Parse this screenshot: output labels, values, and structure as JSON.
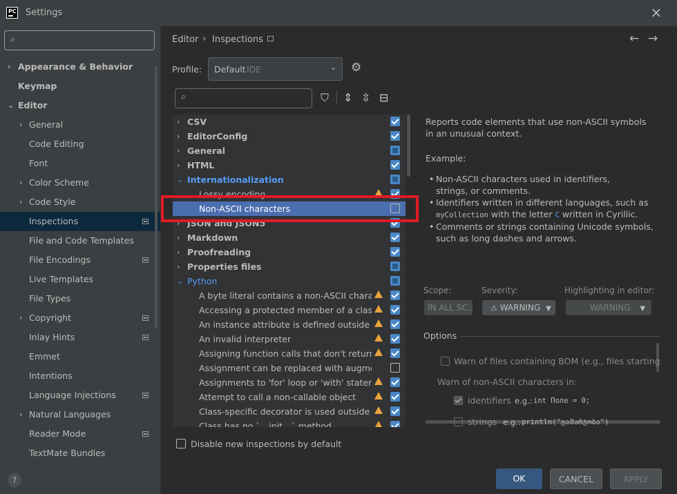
{
  "window": {
    "title": "Settings",
    "logo_text": "PC"
  },
  "sidebar": {
    "items": [
      {
        "label": "Appearance & Behavior",
        "chevron": "›"
      },
      {
        "label": "Keymap",
        "chevron": ""
      },
      {
        "label": "Editor",
        "chevron": "⌄"
      },
      {
        "label": "General",
        "chevron": "›"
      },
      {
        "label": "Code Editing",
        "chevron": ""
      },
      {
        "label": "Font",
        "chevron": ""
      },
      {
        "label": "Color Scheme",
        "chevron": "›"
      },
      {
        "label": "Code Style",
        "chevron": "›"
      },
      {
        "label": "Inspections",
        "chevron": ""
      },
      {
        "label": "File and Code Templates",
        "chevron": ""
      },
      {
        "label": "File Encodings",
        "chevron": ""
      },
      {
        "label": "Live Templates",
        "chevron": ""
      },
      {
        "label": "File Types",
        "chevron": ""
      },
      {
        "label": "Copyright",
        "chevron": "›"
      },
      {
        "label": "Inlay Hints",
        "chevron": ""
      },
      {
        "label": "Emmet",
        "chevron": ""
      },
      {
        "label": "Intentions",
        "chevron": ""
      },
      {
        "label": "Language Injections",
        "chevron": ""
      },
      {
        "label": "Natural Languages",
        "chevron": "›"
      },
      {
        "label": "Reader Mode",
        "chevron": ""
      },
      {
        "label": "TextMate Bundles",
        "chevron": ""
      }
    ],
    "help": "?"
  },
  "header": {
    "breadcrumb_parent": "Editor",
    "breadcrumb_sep": "›",
    "breadcrumb_current": "Inspections",
    "back": "←",
    "forward": "→"
  },
  "profile": {
    "label": "Profile:",
    "value": "Default",
    "scope": "IDE"
  },
  "tree": {
    "rows": [
      {
        "label": "CSV",
        "chevron": "›"
      },
      {
        "label": "EditorConfig",
        "chevron": "›"
      },
      {
        "label": "General",
        "chevron": "›"
      },
      {
        "label": "HTML",
        "chevron": "›"
      },
      {
        "label": "Internationalization",
        "chevron": "⌄"
      },
      {
        "label": "Lossy encoding",
        "chevron": ""
      },
      {
        "label": "Non-ASCII characters",
        "chevron": ""
      },
      {
        "label": "JSON and JSON5",
        "chevron": "›"
      },
      {
        "label": "Markdown",
        "chevron": "›"
      },
      {
        "label": "Proofreading",
        "chevron": "›"
      },
      {
        "label": "Properties files",
        "chevron": "›"
      },
      {
        "label": "Python",
        "chevron": "⌄"
      },
      {
        "label": "A byte literal contains a non-ASCII character",
        "chevron": ""
      },
      {
        "label": "Accessing a protected member of a class or a",
        "chevron": ""
      },
      {
        "label": "An instance attribute is defined outside `__init_",
        "chevron": ""
      },
      {
        "label": "An invalid interpreter",
        "chevron": ""
      },
      {
        "label": "Assigning function calls that don't return anyth",
        "chevron": ""
      },
      {
        "label": "Assignment can be replaced with augmented a",
        "chevron": ""
      },
      {
        "label": "Assignments to 'for' loop or 'with' statement p",
        "chevron": ""
      },
      {
        "label": "Attempt to call a non-callable object",
        "chevron": ""
      },
      {
        "label": "Class-specific decorator is used outside the cla",
        "chevron": ""
      },
      {
        "label": "Class has no `__init__` method",
        "chevron": ""
      }
    ],
    "disable_new_label": "Disable new inspections by default"
  },
  "description": {
    "summary": "Reports code elements that use non-ASCII symbols in an unusual context.",
    "example_label": "Example:",
    "bullet1": "Non-ASCII characters used in identifiers, strings, or comments.",
    "bullet2_a": "Identifiers written in different languages, such as",
    "bullet2_code1": "myCollection",
    "bullet2_b": "with the letter",
    "bullet2_code2": "C",
    "bullet2_c": "written in Cyrillic.",
    "bullet3": "Comments or strings containing Unicode symbols, such as long dashes and arrows."
  },
  "settings": {
    "scope_label": "Scope:",
    "scope_value": "IN ALL SC...",
    "severity_label": "Severity:",
    "severity_value": "WARNING",
    "highlight_label": "Highlighting in editor:",
    "highlight_value": "WARNING"
  },
  "options": {
    "title": "Options",
    "bom_label": "Warn of files containing BOM (e.g., files starting with 'F",
    "warn_in_label": "Warn of non-ASCII characters in:",
    "identifiers_label": "identifiers",
    "identifiers_eg": "e.g.:",
    "identifiers_code": "int Поле = 0;",
    "strings_label": "strings",
    "strings_eg": "e.g.:",
    "strings_code": "println(\"გამარჯობა\")"
  },
  "buttons": {
    "ok": "OK",
    "cancel": "CANCEL",
    "apply": "APPLY"
  },
  "colors": {
    "accent": "#365880",
    "selection": "#4b6eaf",
    "warning": "#e8a33d",
    "highlight_box": "#e11b26"
  }
}
